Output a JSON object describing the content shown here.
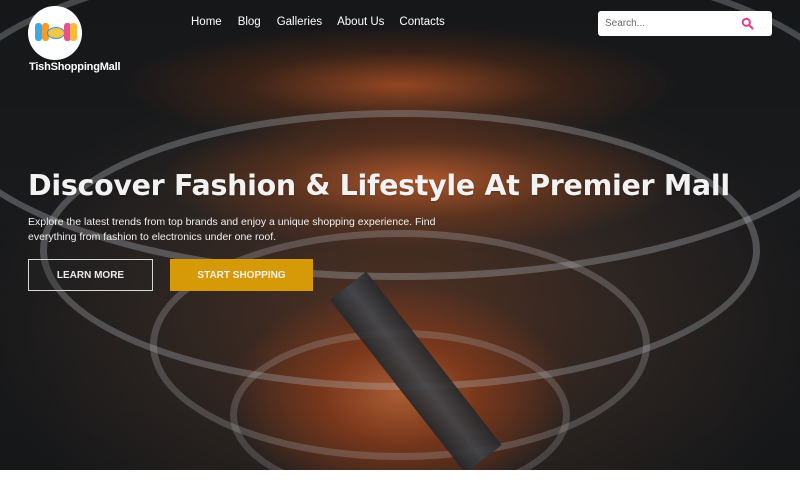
{
  "brand": {
    "name": "TishShoppingMall",
    "logo_icon": "shopping-mall-logo"
  },
  "nav": {
    "items": [
      {
        "label": "Home"
      },
      {
        "label": "Blog"
      },
      {
        "label": "Galleries"
      },
      {
        "label": "About Us"
      },
      {
        "label": "Contacts"
      }
    ]
  },
  "search": {
    "placeholder": "Search...",
    "value": "",
    "icon": "search-icon",
    "icon_color": "#e83e8c"
  },
  "hero": {
    "background": "shopping-mall-atrium-photo",
    "headline": "Discover Fashion & Lifestyle At Premier Mall",
    "subtext": "Explore the latest trends from top brands and enjoy a unique shopping experience. Find everything from fashion to electronics under one roof.",
    "buttons": {
      "learn_more": "LEARN MORE",
      "start_shopping": "START SHOPPING"
    },
    "accent_color": "#d69a08"
  }
}
